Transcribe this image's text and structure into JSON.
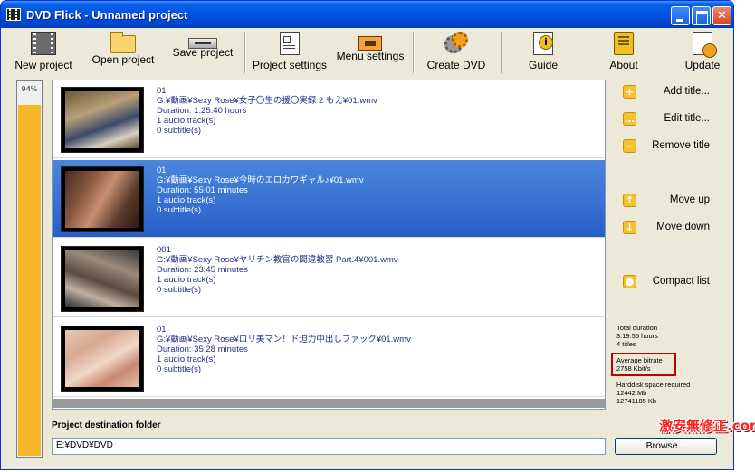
{
  "window": {
    "title": "DVD Flick - Unnamed project"
  },
  "toolbar": {
    "new_project": "New project",
    "open_project": "Open project",
    "save_project": "Save project",
    "project_settings": "Project settings",
    "menu_settings": "Menu settings",
    "create_dvd": "Create DVD",
    "guide": "Guide",
    "about": "About",
    "update": "Update"
  },
  "progress": {
    "label": "94%",
    "value": 0.94
  },
  "titles": [
    {
      "name": "01",
      "path": "G:¥動画¥Sexy Rose¥女子〇生の援〇実録 2 もえ¥01.wmv",
      "duration": "Duration: 1:25:40 hours",
      "audio": "1 audio track(s)",
      "subtitles": "0 subtitle(s)"
    },
    {
      "name": "01",
      "path": "G:¥動画¥Sexy Rose¥今時のエロカワギャル♪¥01.wmv",
      "duration": "Duration: 55:01 minutes",
      "audio": "1 audio track(s)",
      "subtitles": "0 subtitle(s)"
    },
    {
      "name": "001",
      "path": "G:¥動画¥Sexy Rose¥ヤリチン教官の間違教習 Part.4¥001.wmv",
      "duration": "Duration: 23:45 minutes",
      "audio": "1 audio track(s)",
      "subtitles": "0 subtitle(s)"
    },
    {
      "name": "01",
      "path": "G:¥動画¥Sexy Rose¥ロリ美マン！ド迫力中出しファック¥01.wmv",
      "duration": "Duration: 35:28 minutes",
      "audio": "1 audio track(s)",
      "subtitles": "0 subtitle(s)"
    }
  ],
  "sidebar": {
    "add_title": "Add title...",
    "edit_title": "Edit title...",
    "remove_title": "Remove title",
    "move_up": "Move up",
    "move_down": "Move down",
    "compact_list": "Compact list"
  },
  "stats": {
    "total_duration_label": "Total duration",
    "total_duration_value": "3:19:55 hours",
    "titles_count": "4 titles",
    "avg_bitrate_label": "Average bitrate",
    "avg_bitrate_value": "2758 Kbit/s",
    "hdd_label": "Harddisk space required",
    "hdd_mb": "12442 Mb",
    "hdd_kb": "12741185 Kb"
  },
  "destination": {
    "label": "Project destination folder",
    "value": "E:¥DVD¥DVD",
    "browse": "Browse..."
  },
  "watermark": "激安無修正.com",
  "colors": {
    "titlebar": "#0054e3",
    "selection": "#316ac5",
    "progress": "#f6b728",
    "highlight_box": "#c00000"
  }
}
